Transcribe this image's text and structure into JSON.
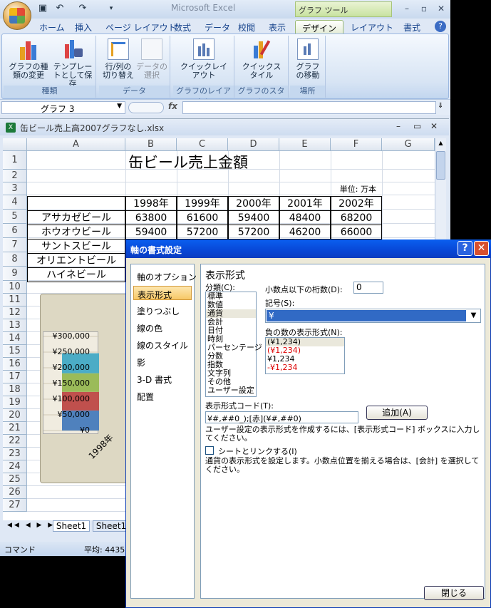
{
  "excel": {
    "app_title": "Microsoft Excel",
    "chart_tools_label": "グラフ ツール",
    "tabs": [
      "ホーム",
      "挿入",
      "ページ レイアウト",
      "数式",
      "データ",
      "校閲",
      "表示",
      "デザイン",
      "レイアウト",
      "書式"
    ],
    "ribbon": {
      "buttons": {
        "change_type": "グラフの種類の変更",
        "save_template": "テンプレートとして保存",
        "switch_row_col": "行/列の切り替え",
        "select_data": "データの選択",
        "quick_layout": "クイックレイアウト",
        "quick_style": "クイックスタイル",
        "move_chart": "グラフの移動"
      },
      "groups": [
        "種類",
        "データ",
        "グラフのレイアウト",
        "グラフのスタイル",
        "場所"
      ]
    },
    "name_box": "グラフ 3",
    "fx": "fx",
    "workbook_title": "缶ビール売上高2007グラフなし.xlsx",
    "columns": [
      "A",
      "B",
      "C",
      "D",
      "E",
      "F",
      "G"
    ],
    "rows": [
      "1",
      "2",
      "3",
      "4",
      "5",
      "6",
      "7",
      "8",
      "9",
      "10",
      "11",
      "12",
      "13",
      "14",
      "15",
      "16",
      "17",
      "18",
      "19",
      "20",
      "21",
      "22",
      "23",
      "24",
      "25",
      "26",
      "27"
    ],
    "sheet": {
      "title": "缶ビール売上金額",
      "unit": "単位: 万本",
      "years": [
        "1998年",
        "1999年",
        "2000年",
        "2001年",
        "2002年"
      ],
      "brands": [
        "アサカゼビール",
        "ホウオウビール",
        "サントスビール",
        "オリエントビール",
        "ハイネビール"
      ],
      "values": [
        [
          "63800",
          "61600",
          "59400",
          "48400",
          "68200"
        ],
        [
          "59400",
          "57200",
          "57200",
          "46200",
          "66000"
        ]
      ]
    },
    "sheet_tabs": [
      "Sheet1",
      "Sheet1"
    ],
    "status": {
      "mode": "コマンド",
      "avg": "平均: 4435"
    }
  },
  "chart_data": {
    "type": "bar",
    "categories": [
      "1998年"
    ],
    "y_ticks": [
      "¥300,000",
      "¥250,000",
      "¥200,000",
      "¥150,000",
      "¥100,000",
      "¥50,000",
      "¥0"
    ],
    "ylim": [
      0,
      300000
    ],
    "series_colors": [
      "#4f81bd",
      "#c0504d",
      "#9bbb59",
      "#4bacc6"
    ]
  },
  "dialog": {
    "title": "軸の書式設定",
    "nav": [
      "軸のオプション",
      "表示形式",
      "塗りつぶし",
      "線の色",
      "線のスタイル",
      "影",
      "3-D 書式",
      "配置"
    ],
    "heading": "表示形式",
    "category_label": "分類(C):",
    "categories": [
      "標準",
      "数値",
      "通貨",
      "会計",
      "日付",
      "時刻",
      "パーセンテージ",
      "分数",
      "指数",
      "文字列",
      "その他",
      "ユーザー設定"
    ],
    "decimals_label": "小数点以下の桁数(D):",
    "decimals_value": "0",
    "symbol_label": "記号(S):",
    "symbol_value": "¥",
    "negative_label": "負の数の表示形式(N):",
    "negative_formats": [
      "(¥1,234)",
      "(¥1,234)",
      "¥1,234",
      "-¥1,234"
    ],
    "code_label": "表示形式コード(T):",
    "code_value": "¥#,##0_);[赤](¥#,##0)",
    "add_button": "追加(A)",
    "help_text": "ユーザー設定の表示形式を作成するには、[表示形式コード] ボックスに入力してください。",
    "link_label": "シートとリンクする(I)",
    "desc_text": "通貨の表示形式を設定します。小数点位置を揃える場合は、[会計] を選択してください。",
    "close_button": "閉じる"
  }
}
